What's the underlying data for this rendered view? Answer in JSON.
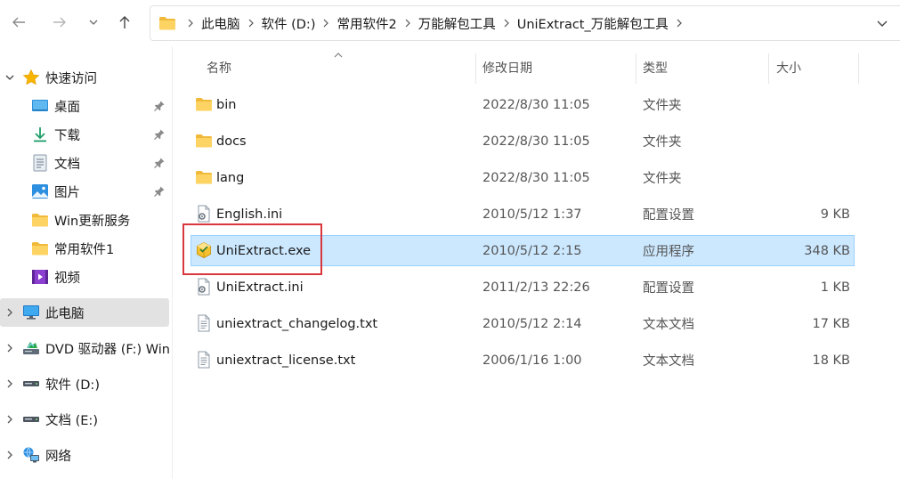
{
  "address_bar": {
    "crumbs": [
      "此电脑",
      "软件 (D:)",
      "常用软件2",
      "万能解包工具",
      "UniExtract_万能解包工具"
    ]
  },
  "sidebar": {
    "items": [
      {
        "label": "快速访问",
        "icon": "star-icon"
      },
      {
        "label": "桌面",
        "icon": "desktop-icon",
        "pinned": true
      },
      {
        "label": "下载",
        "icon": "download-icon",
        "pinned": true
      },
      {
        "label": "文档",
        "icon": "document-icon",
        "pinned": true
      },
      {
        "label": "图片",
        "icon": "pictures-icon",
        "pinned": true
      },
      {
        "label": "Win更新服务",
        "icon": "folder-icon"
      },
      {
        "label": "常用软件1",
        "icon": "folder-icon"
      },
      {
        "label": "视频",
        "icon": "video-icon"
      },
      {
        "label": "此电脑",
        "icon": "computer-icon",
        "selected": true
      },
      {
        "label": "DVD 驱动器 (F:) Win",
        "icon": "dvd-drive-icon"
      },
      {
        "label": "软件 (D:)",
        "icon": "drive-icon"
      },
      {
        "label": "文档 (E:)",
        "icon": "drive-icon"
      },
      {
        "label": "网络",
        "icon": "network-icon"
      }
    ]
  },
  "columns": {
    "name": "名称",
    "modified": "修改日期",
    "type": "类型",
    "size": "大小"
  },
  "files": [
    {
      "name": "bin",
      "modified": "2022/8/30 11:05",
      "type": "文件夹",
      "size": "",
      "icon": "folder-icon"
    },
    {
      "name": "docs",
      "modified": "2022/8/30 11:05",
      "type": "文件夹",
      "size": "",
      "icon": "folder-icon"
    },
    {
      "name": "lang",
      "modified": "2022/8/30 11:05",
      "type": "文件夹",
      "size": "",
      "icon": "folder-icon"
    },
    {
      "name": "English.ini",
      "modified": "2010/5/12 1:37",
      "type": "配置设置",
      "size": "9 KB",
      "icon": "config-file-icon"
    },
    {
      "name": "UniExtract.exe",
      "modified": "2010/5/12 2:15",
      "type": "应用程序",
      "size": "348 KB",
      "icon": "app-exe-icon",
      "selected": true
    },
    {
      "name": "UniExtract.ini",
      "modified": "2011/2/13 22:26",
      "type": "配置设置",
      "size": "1 KB",
      "icon": "config-file-icon"
    },
    {
      "name": "uniextract_changelog.txt",
      "modified": "2010/5/12 2:14",
      "type": "文本文档",
      "size": "17 KB",
      "icon": "text-file-icon"
    },
    {
      "name": "uniextract_license.txt",
      "modified": "2006/1/16 1:00",
      "type": "文本文档",
      "size": "18 KB",
      "icon": "text-file-icon"
    }
  ],
  "colors": {
    "selection_bg": "#cce8ff",
    "selection_border": "#99d1ff",
    "sidebar_selected_bg": "#e2e2e2",
    "annotation_red": "#d9363e",
    "folder_yellow": "#f7c648"
  }
}
